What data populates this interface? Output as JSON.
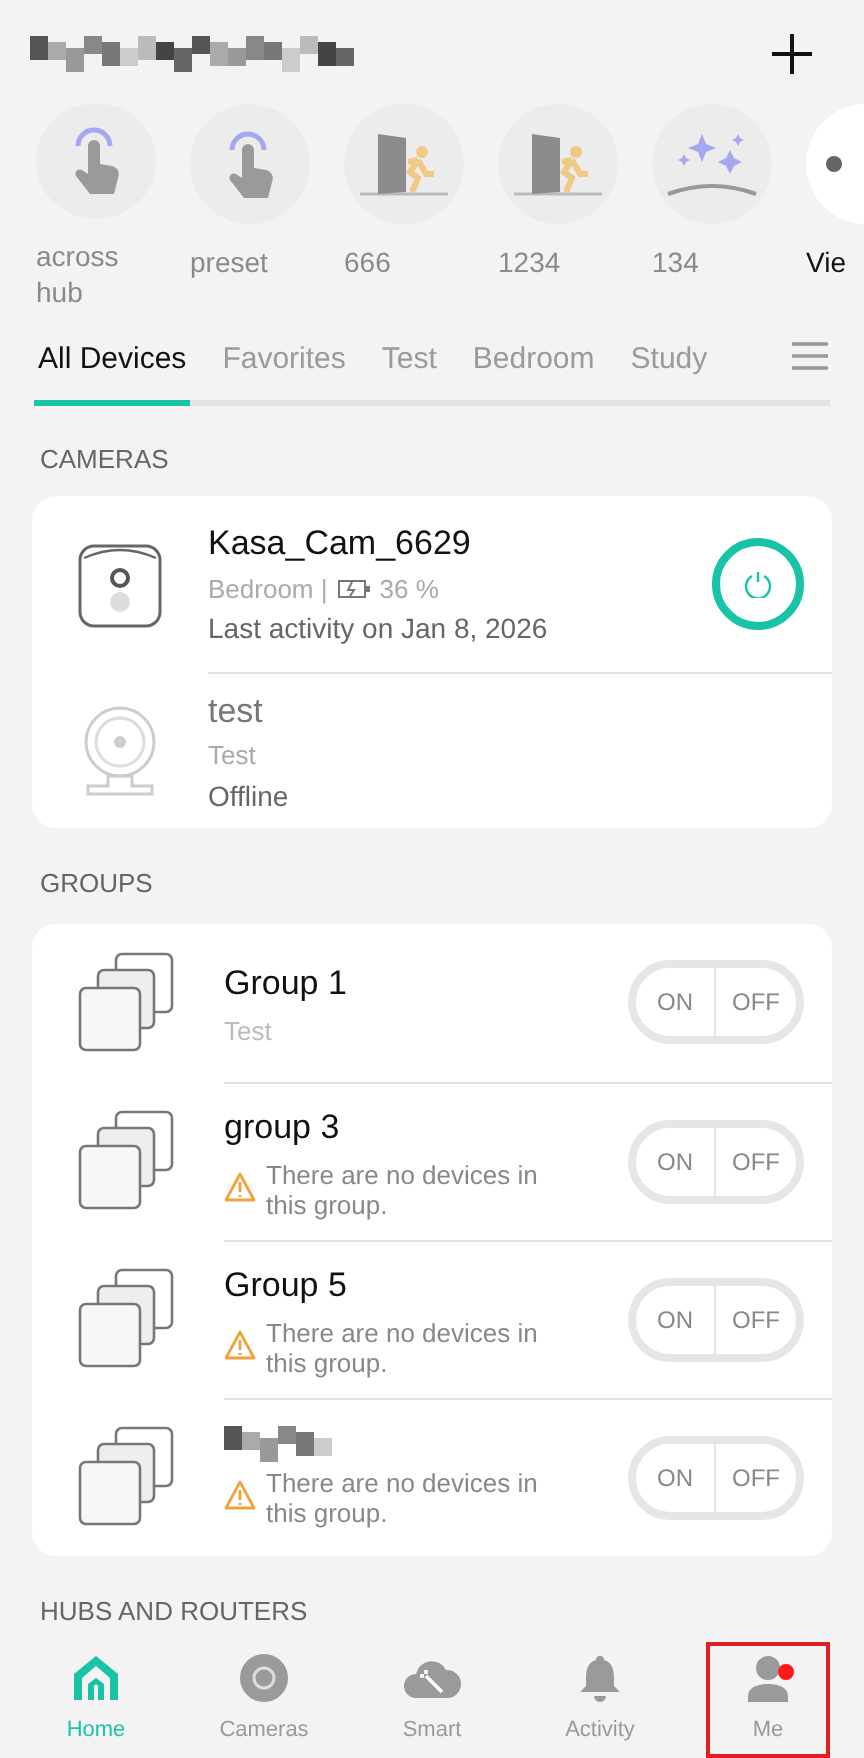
{
  "header": {
    "title_redacted": true
  },
  "scenes": [
    {
      "label": "across hub",
      "kind": "tap"
    },
    {
      "label": "preset",
      "kind": "tap"
    },
    {
      "label": "666",
      "kind": "door"
    },
    {
      "label": "1234",
      "kind": "door"
    },
    {
      "label": "134",
      "kind": "sparkle"
    },
    {
      "label": "Vie",
      "kind": "more"
    }
  ],
  "tabs": [
    {
      "label": "All Devices",
      "selected": true
    },
    {
      "label": "Favorites",
      "selected": false
    },
    {
      "label": "Test",
      "selected": false
    },
    {
      "label": "Bedroom",
      "selected": false
    },
    {
      "label": "Study",
      "selected": false
    }
  ],
  "cameras": {
    "heading": "CAMERAS",
    "items": [
      {
        "kind": "battery",
        "name": "Kasa_Cam_6629",
        "room": "Bedroom |",
        "battery": "36 %",
        "status": "Last activity on Jan 8, 2026",
        "online": true
      },
      {
        "kind": "round",
        "name": "test",
        "room": "Test",
        "status": "Offline",
        "online": false
      }
    ]
  },
  "groups": {
    "heading": "GROUPS",
    "items": [
      {
        "name": "Group 1",
        "note": "Test",
        "warning": false,
        "on_label": "ON",
        "off_label": "OFF"
      },
      {
        "name": "group 3",
        "note": "There are no devices in this group.",
        "warning": true,
        "on_label": "ON",
        "off_label": "OFF"
      },
      {
        "name": "Group 5",
        "note": "There are no devices in this group.",
        "warning": true,
        "on_label": "ON",
        "off_label": "OFF"
      },
      {
        "name_redacted": true,
        "note": "There are no devices in this group.",
        "warning": true,
        "on_label": "ON",
        "off_label": "OFF"
      }
    ]
  },
  "hubs_heading": "HUBS AND ROUTERS",
  "nav": [
    {
      "label": "Home",
      "kind": "home",
      "selected": true,
      "badge": false,
      "highlighted": false
    },
    {
      "label": "Cameras",
      "kind": "camera",
      "selected": false,
      "badge": false,
      "highlighted": false
    },
    {
      "label": "Smart",
      "kind": "smart",
      "selected": false,
      "badge": false,
      "highlighted": false
    },
    {
      "label": "Activity",
      "kind": "bell",
      "selected": false,
      "badge": false,
      "highlighted": false
    },
    {
      "label": "Me",
      "kind": "person",
      "selected": false,
      "badge": true,
      "highlighted": true
    }
  ]
}
